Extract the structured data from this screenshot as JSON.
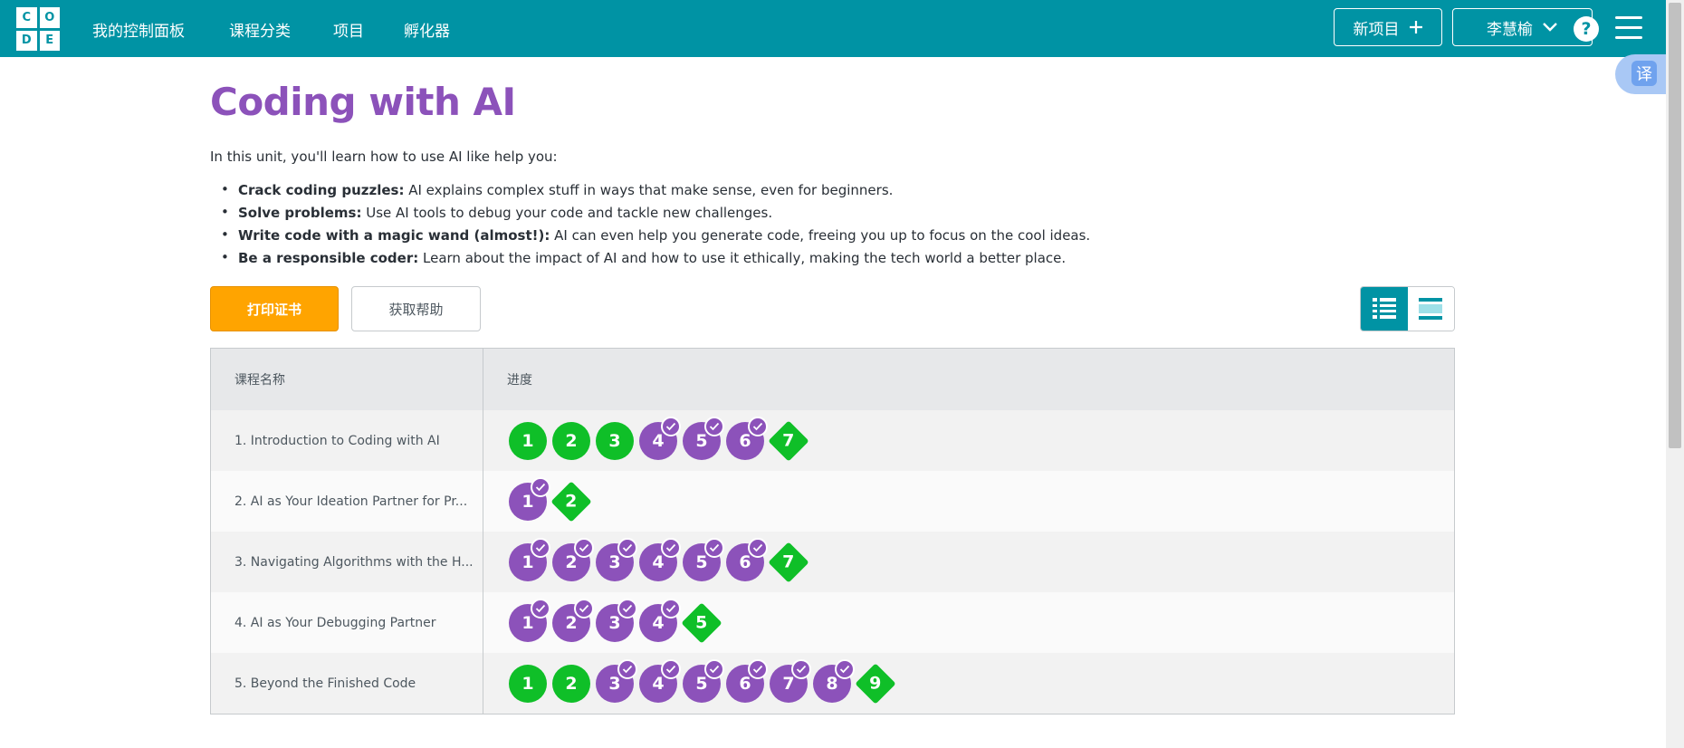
{
  "header": {
    "logo_letters": [
      "C",
      "O",
      "D",
      "E"
    ],
    "nav": [
      "我的控制面板",
      "课程分类",
      "项目",
      "孵化器"
    ],
    "new_project_label": "新项目",
    "user_label": "李慧榆",
    "help_label": "?",
    "translate_label": "译"
  },
  "unit": {
    "title": "Coding with AI",
    "intro": "In this unit, you'll learn how to use AI like help you:",
    "bullets": [
      {
        "bold": "Crack coding puzzles:",
        "text": " AI explains complex stuff in ways that make sense, even for beginners."
      },
      {
        "bold": "Solve problems:",
        "text": " Use AI tools to debug your code and tackle new challenges."
      },
      {
        "bold": "Write code with a magic wand (almost!):",
        "text": " AI can even help you generate code, freeing you up to focus on the cool ideas."
      },
      {
        "bold": "Be a responsible coder:",
        "text": " Learn about the impact of AI and how to use it ethically, making the tech world a better place."
      }
    ]
  },
  "actions": {
    "print_label": "打印证书",
    "help_label": "获取帮助"
  },
  "table": {
    "col_name": "课程名称",
    "col_progress": "进度",
    "lessons": [
      {
        "name": "1. Introduction to Coding with AI",
        "levels": [
          {
            "n": "1",
            "kind": "green",
            "check": false
          },
          {
            "n": "2",
            "kind": "green",
            "check": false
          },
          {
            "n": "3",
            "kind": "green",
            "check": false
          },
          {
            "n": "4",
            "kind": "purple",
            "check": true
          },
          {
            "n": "5",
            "kind": "purple",
            "check": true
          },
          {
            "n": "6",
            "kind": "purple",
            "check": true
          },
          {
            "n": "7",
            "kind": "diamond",
            "check": false
          }
        ]
      },
      {
        "name": "2. AI as Your Ideation Partner for Pr...",
        "levels": [
          {
            "n": "1",
            "kind": "purple",
            "check": true
          },
          {
            "n": "2",
            "kind": "diamond",
            "check": false
          }
        ]
      },
      {
        "name": "3. Navigating Algorithms with the H...",
        "levels": [
          {
            "n": "1",
            "kind": "purple",
            "check": true
          },
          {
            "n": "2",
            "kind": "purple",
            "check": true
          },
          {
            "n": "3",
            "kind": "purple",
            "check": true
          },
          {
            "n": "4",
            "kind": "purple",
            "check": true
          },
          {
            "n": "5",
            "kind": "purple",
            "check": true
          },
          {
            "n": "6",
            "kind": "purple",
            "check": true
          },
          {
            "n": "7",
            "kind": "diamond",
            "check": false
          }
        ]
      },
      {
        "name": "4. AI as Your Debugging Partner",
        "levels": [
          {
            "n": "1",
            "kind": "purple",
            "check": true
          },
          {
            "n": "2",
            "kind": "purple",
            "check": true
          },
          {
            "n": "3",
            "kind": "purple",
            "check": true
          },
          {
            "n": "4",
            "kind": "purple",
            "check": true
          },
          {
            "n": "5",
            "kind": "diamond",
            "check": false
          }
        ]
      },
      {
        "name": "5. Beyond the Finished Code",
        "levels": [
          {
            "n": "1",
            "kind": "green",
            "check": false
          },
          {
            "n": "2",
            "kind": "green",
            "check": false
          },
          {
            "n": "3",
            "kind": "purple",
            "check": true
          },
          {
            "n": "4",
            "kind": "purple",
            "check": true
          },
          {
            "n": "5",
            "kind": "purple",
            "check": true
          },
          {
            "n": "6",
            "kind": "purple",
            "check": true
          },
          {
            "n": "7",
            "kind": "purple",
            "check": true
          },
          {
            "n": "8",
            "kind": "purple",
            "check": true
          },
          {
            "n": "9",
            "kind": "diamond",
            "check": false
          }
        ]
      }
    ]
  }
}
